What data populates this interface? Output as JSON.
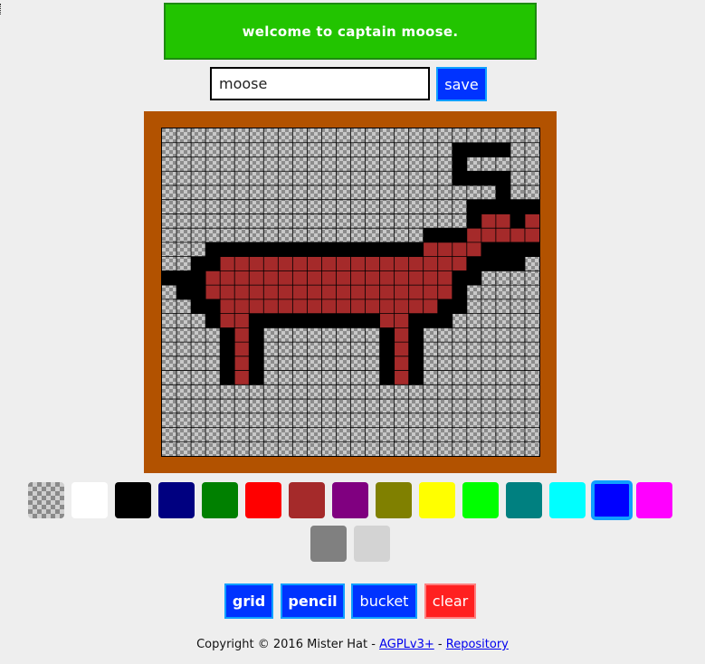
{
  "header": {
    "welcome": "welcome to captain moose."
  },
  "name_field": {
    "value": "moose"
  },
  "actions": {
    "save_label": "save"
  },
  "drawing": {
    "cols": 26,
    "rows": 23,
    "legend": {
      ".": "transparent",
      "K": "#000000",
      "R": "#a52a2a"
    },
    "pixels": [
      "..........................",
      "....................KKKK..",
      "....................K.....",
      "....................KKKK..",
      ".......................K..",
      ".....................KKKKK",
      ".....................KRRKR",
      "..................KKKRRRRR",
      "...KKKKKKKKKKKKKKKRRRRKKKK",
      "..KKRRRRRRRRRRRRRRRRRKKKK.",
      "KKKRRRRRRRRRRRRRRRRRKK....",
      ".KKRRRRRRRRRRRRRRRRRK.....",
      "..KKRRRRRRRRRRRRRRRKK.....",
      "...KRRKKKKKKKKKRRKKK......",
      "....KRK........KRK........",
      "....KRK........KRK........",
      "....KRK........KRK........",
      "....KRK........KRK........"
    ]
  },
  "palette": {
    "colors": [
      "transparent",
      "#ffffff",
      "#000000",
      "#000080",
      "#008000",
      "#ff0000",
      "#a52a2a",
      "#800080",
      "#808000",
      "#ffff00",
      "#00ff00",
      "#008080",
      "#00ffff",
      "#0000ff",
      "#ff00ff",
      "#808080",
      "#d3d3d3"
    ],
    "selected_index": 13
  },
  "tools": {
    "grid_label": "grid",
    "pencil_label": "pencil",
    "bucket_label": "bucket",
    "clear_label": "clear"
  },
  "footer": {
    "copyright": "Copyright © 2016 Mister Hat - ",
    "license_link": "AGPLv3+",
    "separator": " - ",
    "repo_link": "Repository"
  }
}
